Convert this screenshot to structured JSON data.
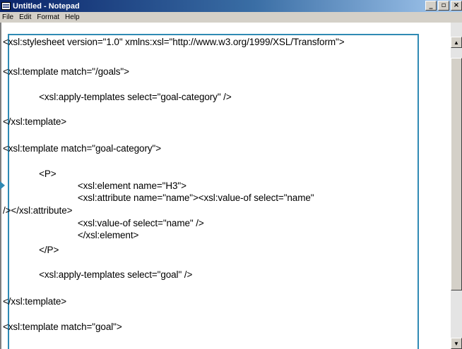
{
  "window": {
    "title": "Untitled - Notepad",
    "buttons": {
      "minimize": "_",
      "maximize": "▫",
      "close": "×"
    }
  },
  "menubar": {
    "items": [
      {
        "label": "File"
      },
      {
        "label": "Edit"
      },
      {
        "label": "Format"
      },
      {
        "label": "Help"
      }
    ]
  },
  "editor": {
    "lines": [
      "<xsl:stylesheet version=\"1.0\" xmlns:xsl=\"http://www.w3.org/1999/XSL/Transform\">",
      "<xsl:template match=\"/goals\">",
      "              <xsl:apply-templates select=\"goal-category\" />",
      "</xsl:template>",
      "<xsl:template match=\"goal-category\">",
      "              <P>",
      "                             <xsl:element name=\"H3\">",
      "                             <xsl:attribute name=\"name\"><xsl:value-of select=\"name\"",
      "/></xsl:attribute>",
      "                             <xsl:value-of select=\"name\" />",
      "                             </xsl:element>",
      "              </P>",
      "              <xsl:apply-templates select=\"goal\" />",
      "</xsl:template>",
      "<xsl:template match=\"goal\">"
    ]
  }
}
